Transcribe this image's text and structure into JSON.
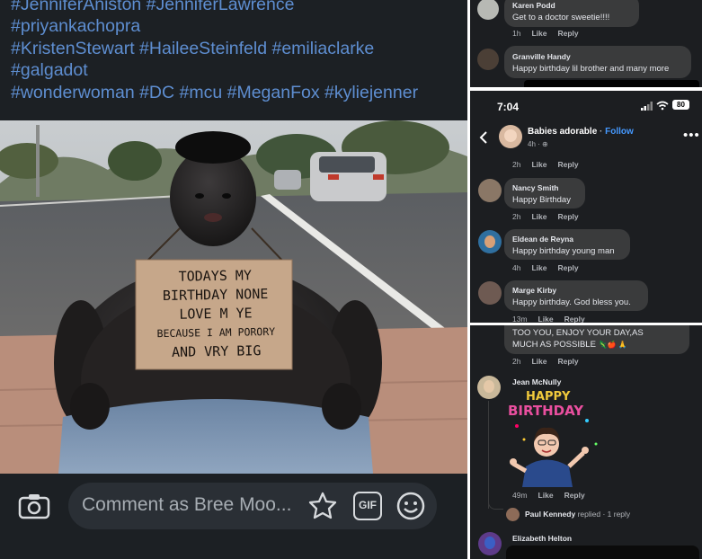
{
  "post": {
    "hashtag_lines": [
      "#JenniferAniston #JenniferLawrence",
      "#priyankachopra",
      "#KristenStewart #HaileeSteinfeld #emiliaclarke",
      "#galgadot",
      "#wonderwoman #DC #mcu #MeganFox #kyliejenner"
    ],
    "sign_lines": [
      "TODAYS MY",
      "BIRTHDAY NONE",
      "LOVE M YE",
      "BECAUSE I AM PORORY",
      "AND VRY BIG"
    ]
  },
  "comment_bar": {
    "placeholder": "Comment as Bree Moo...",
    "camera_icon": "camera-icon",
    "sticker_icon": "sticker-icon",
    "gif_label": "GIF",
    "emoji_icon": "emoji-icon"
  },
  "panel1": {
    "comments": [
      {
        "name": "Karen Podd",
        "text": "Get to a doctor sweetie!!!!",
        "time": "1h",
        "like": "Like",
        "reply": "Reply"
      },
      {
        "name": "Granville Handy",
        "text": "Happy birthday lil brother and many more"
      }
    ]
  },
  "panel2": {
    "status_time": "7:04",
    "battery": "80",
    "page_name": "Babies adorable",
    "separator": " · ",
    "follow": "Follow",
    "page_time": "4h · ",
    "top_meta": {
      "time": "2h",
      "like": "Like",
      "reply": "Reply"
    },
    "comments": [
      {
        "name": "Nancy Smith",
        "text": "Happy  Birthday",
        "time": "2h",
        "like": "Like",
        "reply": "Reply"
      },
      {
        "name": "Eldean de Reyna",
        "text": "Happy birthday young man",
        "time": "4h",
        "like": "Like",
        "reply": "Reply"
      },
      {
        "name": "Marge Kirby",
        "text": "Happy birthday. God bless you.",
        "time": "13m",
        "like": "Like",
        "reply": "Reply"
      }
    ]
  },
  "panel3": {
    "top_text_1": "TOO YOU, ENJOY YOUR DAY,AS",
    "top_text_2": "MUCH AS POSSIBLE",
    "top_meta": {
      "time": "2h",
      "like": "Like",
      "reply": "Reply"
    },
    "jean": {
      "name": "Jean McNully",
      "sticker_word_1": "HAPPY",
      "sticker_word_2": "BIRTHDAY",
      "time": "49m",
      "like": "Like",
      "reply": "Reply"
    },
    "reply_line": {
      "name": "Paul Kennedy",
      "action": " replied",
      "count": " · 1 reply"
    },
    "last_name": "Elizabeth Helton"
  },
  "colors": {
    "link": "#4599ff",
    "hashtag": "#5e8ed1",
    "bubble": "#3a3b3c",
    "bg_dark": "#1c1e21"
  }
}
